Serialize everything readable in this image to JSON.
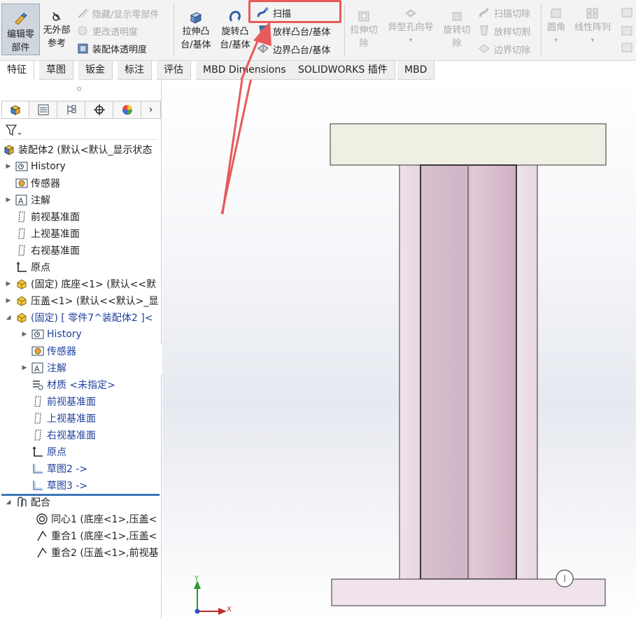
{
  "ribbon": {
    "edit_part_line1": "编辑零",
    "edit_part_line2": "部件",
    "no_external_line1": "无外部",
    "no_external_line2": "参考",
    "hide_show_parts": "隐藏/显示零部件",
    "change_transparency": "更改透明度",
    "assembly_transparency": "装配体透明度",
    "extrude_line1": "拉伸凸",
    "extrude_line2": "台/基体",
    "revolve_line1": "旋转凸",
    "revolve_line2": "台/基体",
    "sweep": "扫描",
    "loft": "放样凸台/基体",
    "boundary": "边界凸台/基体",
    "extrude_cut_line1": "拉伸切",
    "extrude_cut_line2": "除",
    "hole_wizard": "异型孔向导",
    "revolve_cut_line1": "旋转切",
    "revolve_cut_line2": "除",
    "sweep_cut": "扫描切除",
    "loft_cut": "放样切割",
    "boundary_cut": "边界切除",
    "fillet": "圆角",
    "linear_pattern": "线性阵列"
  },
  "tabs": [
    {
      "label": "特征"
    },
    {
      "label": "草图"
    },
    {
      "label": "钣金"
    },
    {
      "label": "标注"
    },
    {
      "label": "评估"
    },
    {
      "label": "MBD Dimensions"
    },
    {
      "label": "SOLIDWORKS 插件"
    },
    {
      "label": "MBD"
    }
  ],
  "tree": {
    "root": "装配体2  (默认<默认_显示状态",
    "history": "History",
    "sensors": "传感器",
    "annotations": "注解",
    "front_plane": "前视基准面",
    "top_plane": "上视基准面",
    "right_plane": "右视基准面",
    "origin": "原点",
    "base": "(固定) 底座<1> (默认<<默",
    "cover": "压盖<1> (默认<<默认>_显",
    "part7": "(固定) [ 零件7^装配体2 ]<",
    "sub_history": "History",
    "sub_sensors": "传感器",
    "sub_annotations": "注解",
    "material": "材质 <未指定>",
    "sub_front_plane": "前视基准面",
    "sub_top_plane": "上视基准面",
    "sub_right_plane": "右视基准面",
    "sub_origin": "原点",
    "sketch2": "草图2 ->",
    "sketch3": "草图3 ->",
    "mates": "配合",
    "mate1": "同心1 (底座<1>,压盖<",
    "mate2": "重合1 (底座<1>,压盖<",
    "mate3": "重合2 (压盖<1>,前视基"
  },
  "triad": {
    "y": "Y",
    "x": "X"
  },
  "colors": {
    "highlight": "#e85a5a",
    "tree_blue": "#1f3f9e",
    "separator": "#3c78b6"
  }
}
